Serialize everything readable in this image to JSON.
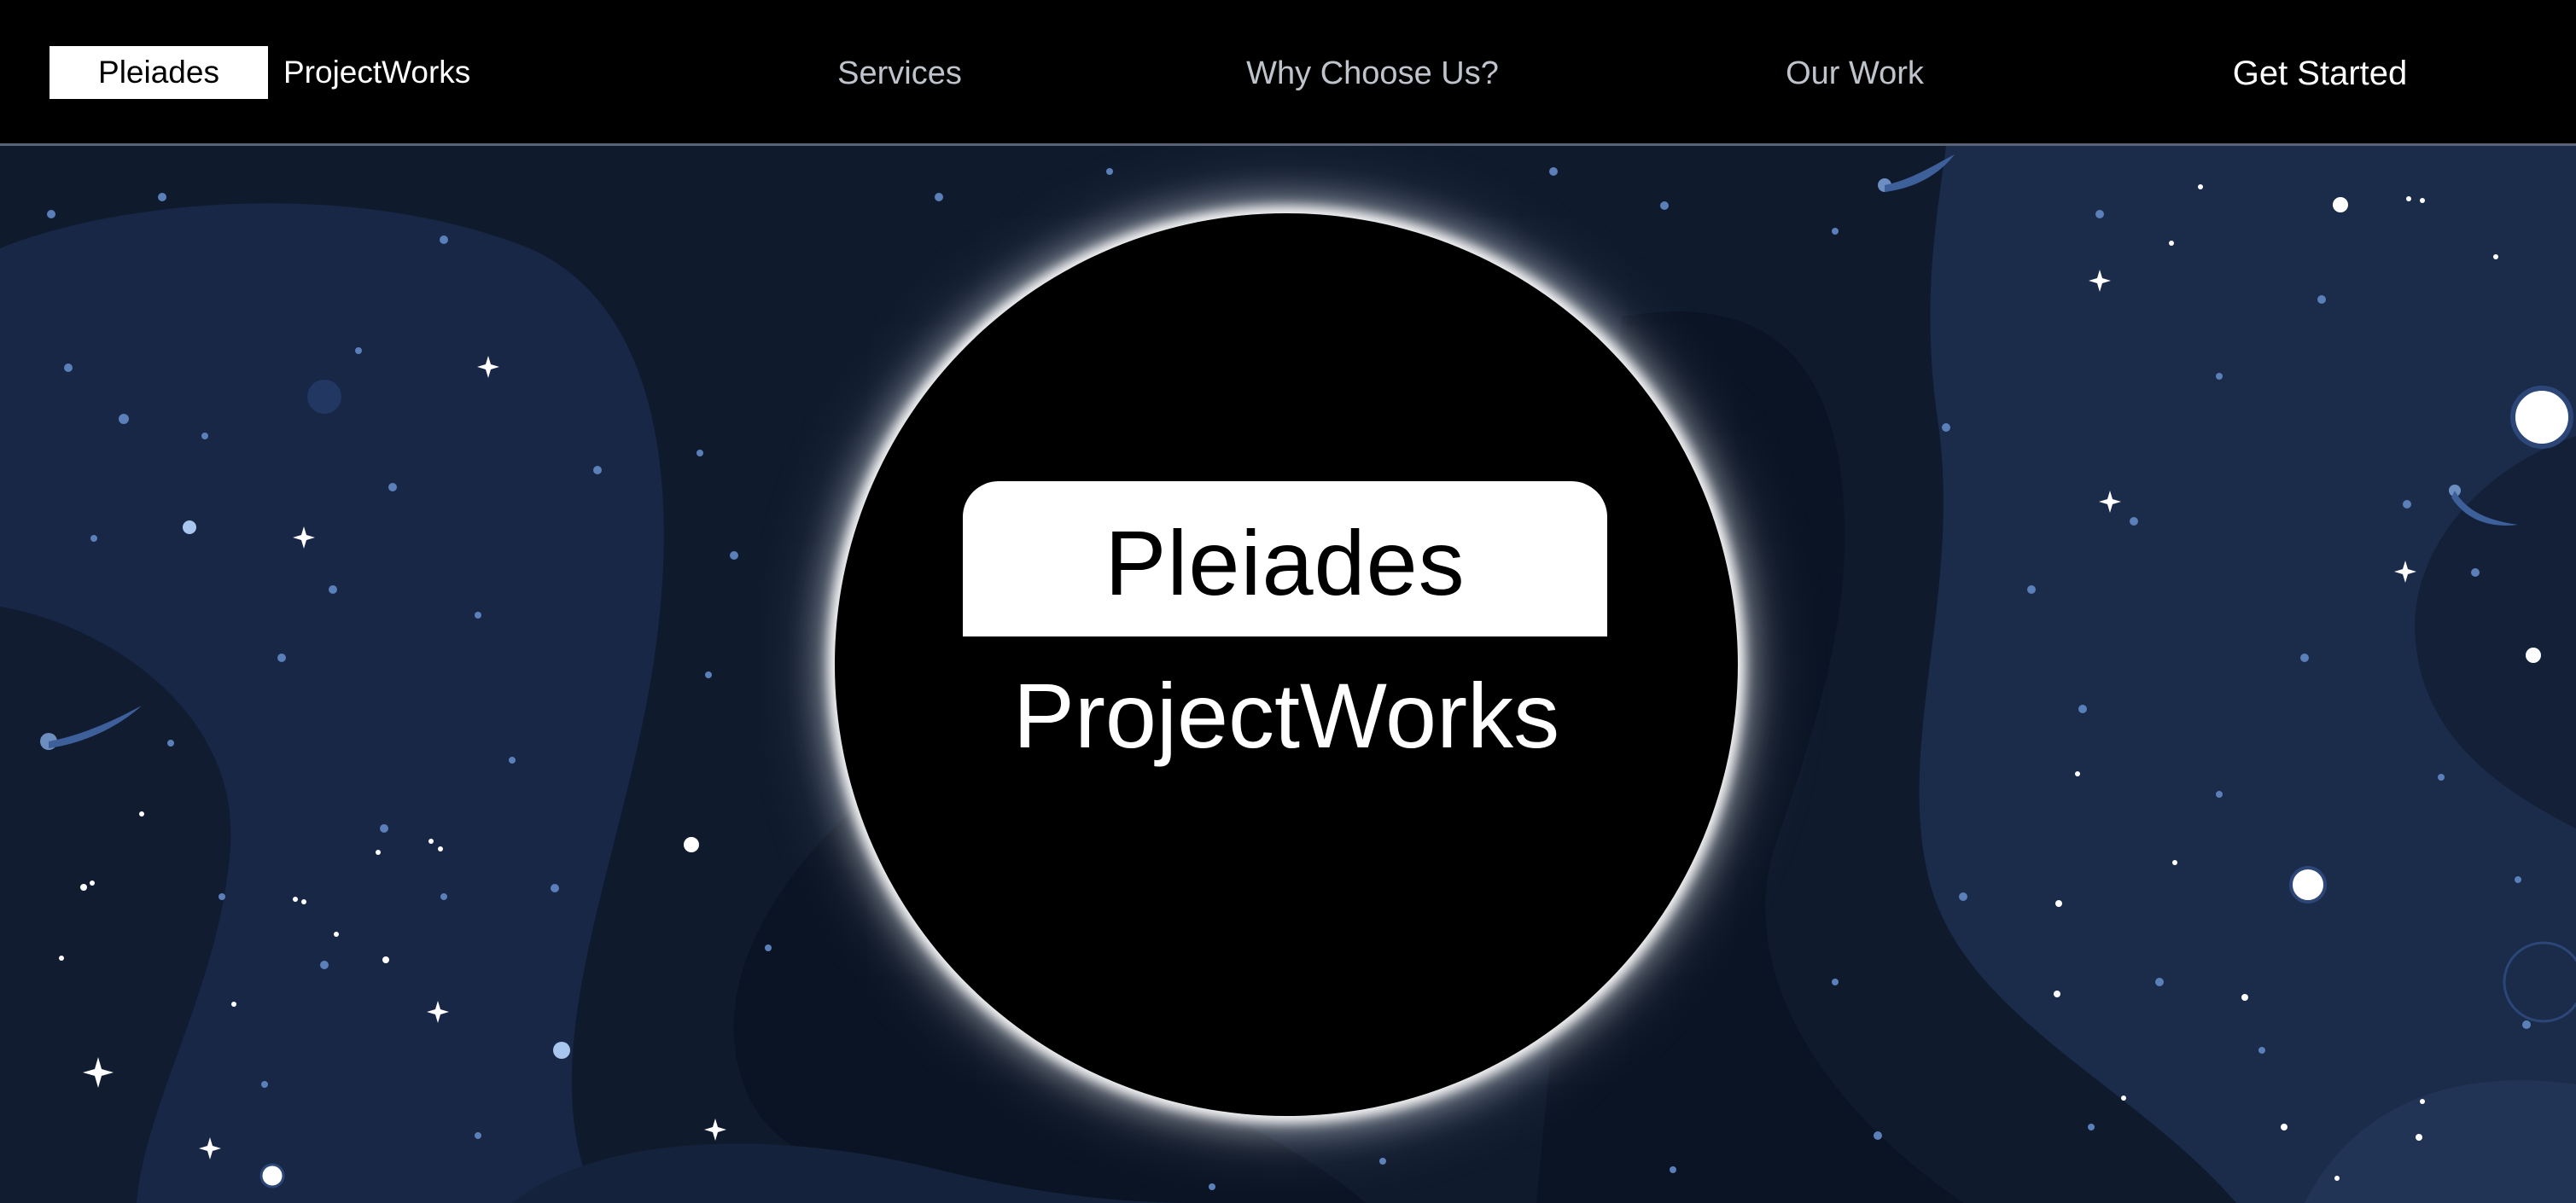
{
  "nav": {
    "brand_box_text": "Pleiades",
    "brand_text": "ProjectWorks",
    "links": [
      {
        "label": "Services"
      },
      {
        "label": "Why Choose Us?"
      },
      {
        "label": "Our Work"
      }
    ],
    "cta_label": "Get Started"
  },
  "hero": {
    "badge_text": "Pleiades",
    "subtitle": "ProjectWorks"
  },
  "colors": {
    "nav_bg": "#000000",
    "hero_bg": "#101b2e",
    "wave_dark": "#0c1526",
    "wave_light": "#1b2a48",
    "star_blue": "#5b7fb8",
    "orb": "#000000"
  },
  "icons": [
    "sparkle-star-icon",
    "planet-icon",
    "comet-icon"
  ]
}
